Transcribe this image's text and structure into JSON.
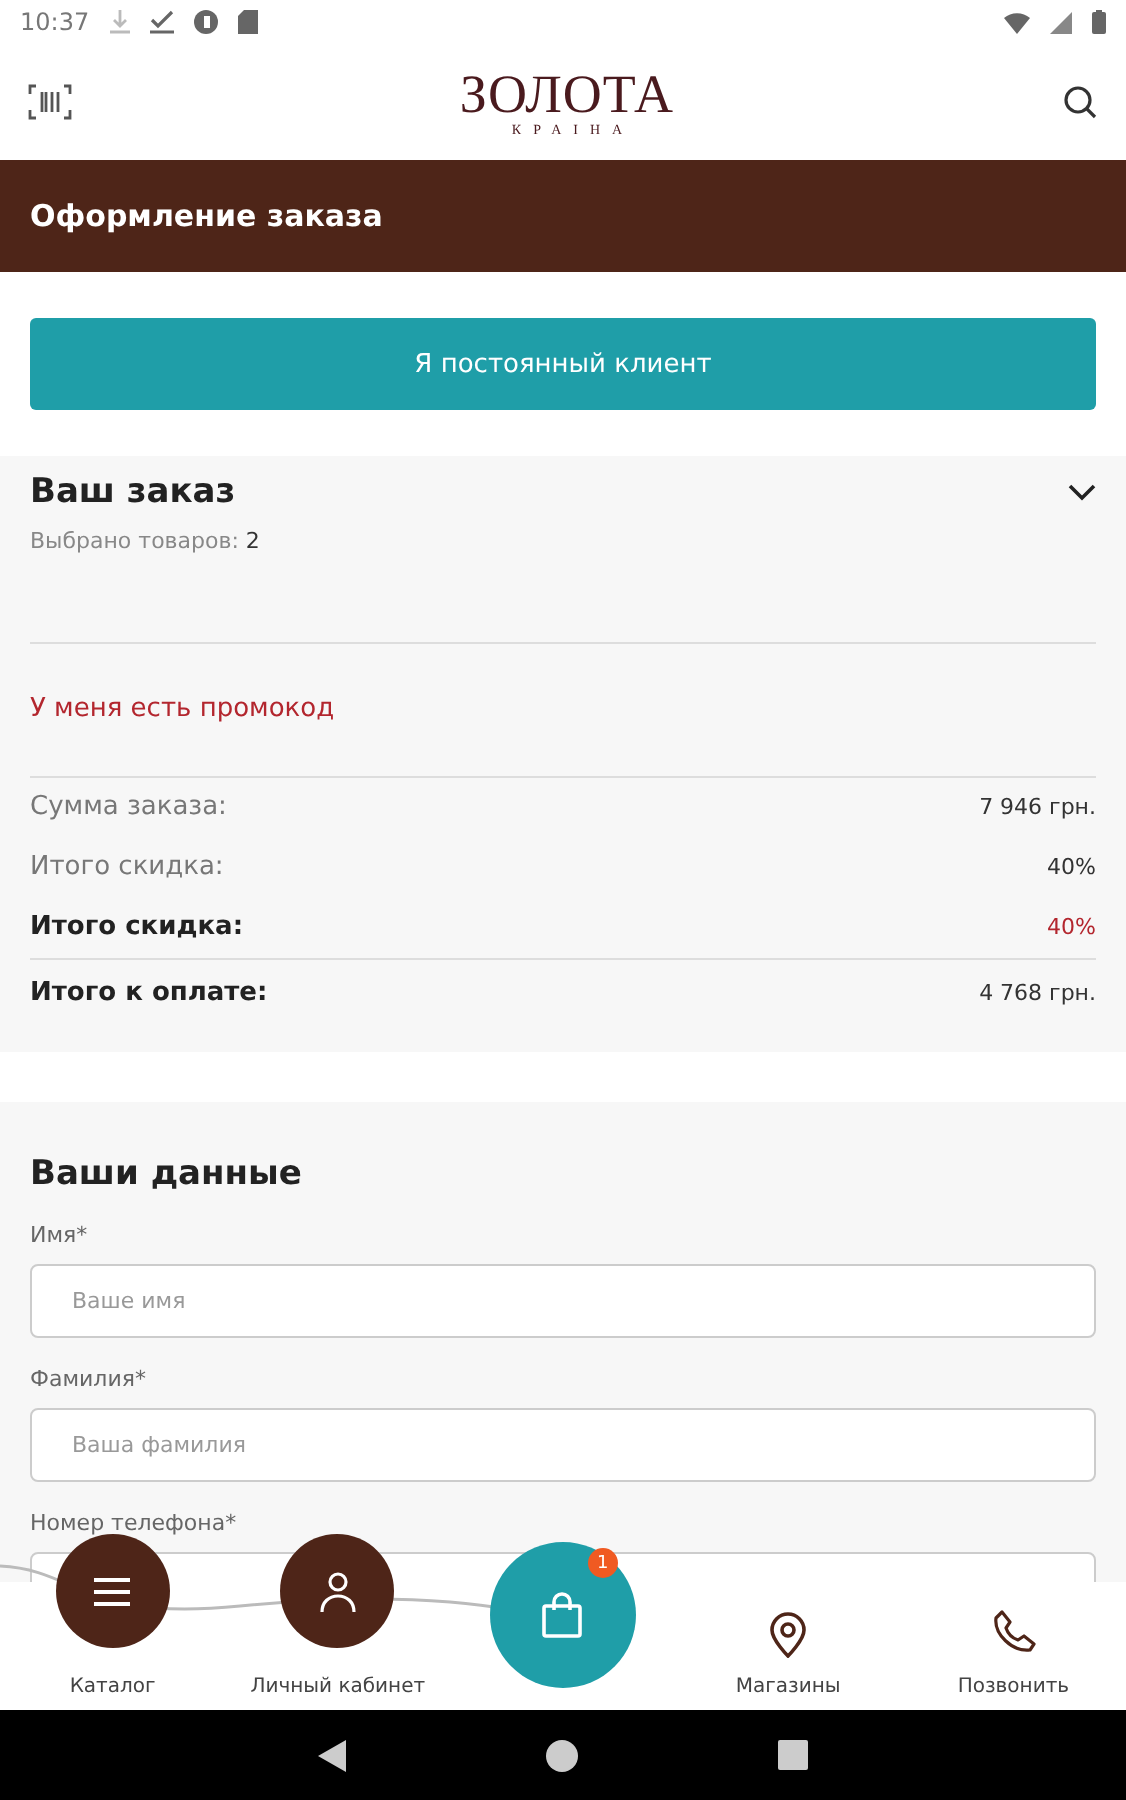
{
  "status_bar": {
    "time": "10:37"
  },
  "header": {
    "logo_title": "ЗОЛОТА",
    "logo_subtitle": "КРАIНА"
  },
  "title_bar": {
    "title": "Оформление заказа"
  },
  "regular_client_button": "Я постоянный клиент",
  "order": {
    "title": "Ваш заказ",
    "expanded": false,
    "items_label": "Выбрано товаров:",
    "items_count": "2",
    "promo_link": "У меня есть промокод",
    "summary": [
      {
        "label": "Сумма заказа:",
        "value": "7 946 грн.",
        "kind": "plain"
      },
      {
        "label": "Итого скидка:",
        "value": "40%",
        "kind": "plain"
      },
      {
        "label": "Итого скидка:",
        "value": "40%",
        "kind": "accent"
      },
      {
        "label": "Итого к оплате:",
        "value": "4 768 грн.",
        "kind": "total"
      }
    ]
  },
  "form": {
    "title": "Ваши данные",
    "fields": [
      {
        "label": "Имя*",
        "placeholder": "Ваше имя"
      },
      {
        "label": "Фамилия*",
        "placeholder": "Ваша фамилия"
      },
      {
        "label": "Номер телефона*"
      }
    ]
  },
  "bottom_nav": {
    "items": [
      {
        "label": "Каталог",
        "kind": "menu"
      },
      {
        "label": "Личный кабинет",
        "kind": "profile"
      },
      {
        "kind": "cart",
        "badge": "1"
      },
      {
        "label": "Магазины",
        "kind": "stores"
      },
      {
        "label": "Позвонить",
        "kind": "call"
      }
    ]
  }
}
